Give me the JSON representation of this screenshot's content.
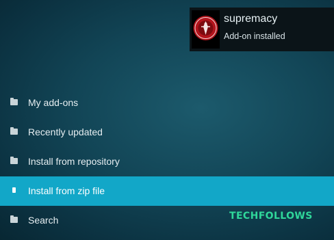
{
  "notification": {
    "title": "supremacy",
    "subtitle": "Add-on installed",
    "icon": "supremacy-logo"
  },
  "menu": {
    "items": [
      {
        "label": "My add-ons",
        "icon": "folder-icon",
        "selected": false
      },
      {
        "label": "Recently updated",
        "icon": "folder-icon",
        "selected": false
      },
      {
        "label": "Install from repository",
        "icon": "folder-icon",
        "selected": false
      },
      {
        "label": "Install from zip file",
        "icon": "zip-icon",
        "selected": true
      },
      {
        "label": "Search",
        "icon": "folder-icon",
        "selected": false
      }
    ]
  },
  "watermark": "TECHFOLLOWS",
  "colors": {
    "selected_background": "#12a7c8",
    "background": "#124556",
    "watermark": "#2fd79a"
  }
}
